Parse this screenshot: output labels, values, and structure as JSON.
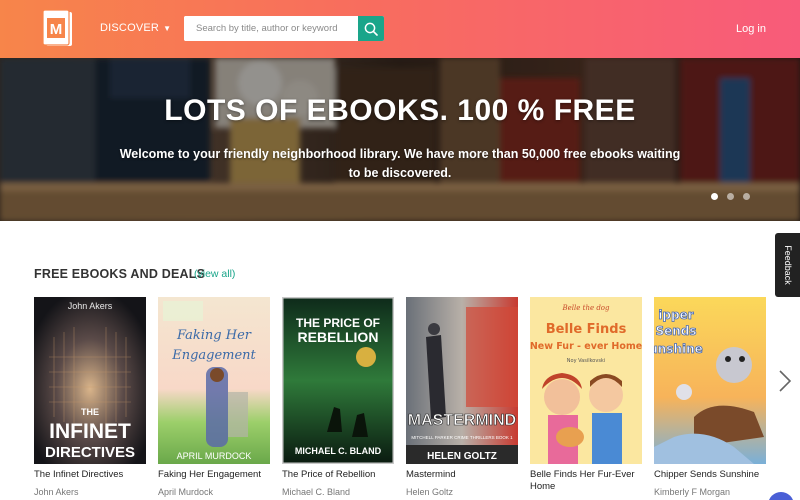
{
  "header": {
    "logo_letter": "M",
    "discover_label": "DISCOVER",
    "search_placeholder": "Search by title, author or keyword",
    "login_label": "Log in",
    "colors": {
      "accent": "#1aa58a",
      "gradient_start": "#f7854a",
      "gradient_end": "#f85b7a"
    }
  },
  "hero": {
    "title": "LOTS OF EBOOKS. 100 % FREE",
    "subtitle": "Welcome to your friendly neighborhood library. We have more than 50,000 free ebooks waiting to be discovered.",
    "slide_count": 3,
    "active_slide": 1
  },
  "section": {
    "title": "FREE EBOOKS AND DEALS",
    "view_all": "(view all)"
  },
  "books": [
    {
      "title": "The Infinet Directives",
      "author": "John Akers",
      "cover_author": "John Akers",
      "cover_title_1": "THE",
      "cover_title_2": "INFINET",
      "cover_title_3": "DIRECTIVES"
    },
    {
      "title": "Faking Her Engagement",
      "author": "April Murdock",
      "cover_title_1": "Faking Her",
      "cover_title_2": "Engagement",
      "cover_author": "APRIL MURDOCK"
    },
    {
      "title": "The Price of Rebellion",
      "author": "Michael C. Bland",
      "cover_title_1": "THE PRICE OF",
      "cover_title_2": "REBELLION",
      "cover_author": "MICHAEL C. BLAND"
    },
    {
      "title": "Mastermind",
      "author": "Helen Goltz",
      "cover_title_1": "MASTERMIND",
      "cover_series": "MITCHELL PARKER CRIME THRILLERS BOOK 1",
      "cover_author": "HELEN GOLTZ"
    },
    {
      "title": "Belle Finds Her Fur-Ever Home",
      "author": "",
      "cover_top": "Belle the dog",
      "cover_title_1": "Belle Finds",
      "cover_title_2": "New Fur - ever Home",
      "cover_author": "Noy Vasilkovski"
    },
    {
      "title": "Chipper Sends Sunshine",
      "author": "Kimberly F Morgan",
      "cover_title_1": "ipper",
      "cover_title_2": "Sends",
      "cover_title_3": "unshine"
    }
  ],
  "feedback_label": "Feedback",
  "icons": [
    "book-logo-icon",
    "caret-down-icon",
    "search-icon",
    "chevron-right-icon"
  ]
}
